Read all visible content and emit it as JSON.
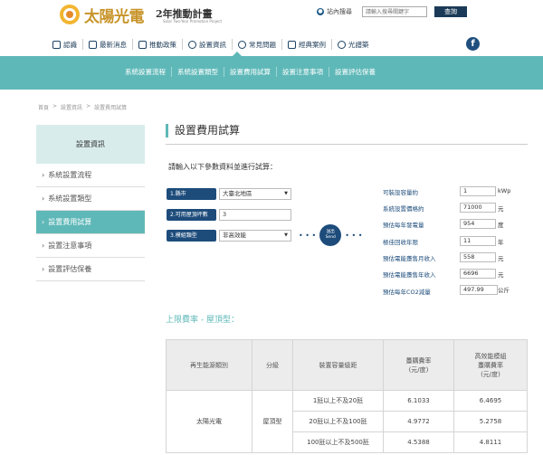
{
  "header": {
    "logo_title": "太陽光電",
    "logo_subtitle": "2年推動計畫",
    "logo_en": "Solar Two-Year Promotion Project",
    "sitemap_label": "站內搜尋",
    "search_placeholder": "請輸入搜尋關鍵字",
    "search_button": "查詢"
  },
  "nav": {
    "items": [
      {
        "label": "認識",
        "icon": "phone-icon"
      },
      {
        "label": "最新消息",
        "icon": "chart-icon"
      },
      {
        "label": "推動政策",
        "icon": "building-icon"
      },
      {
        "label": "設置資訊",
        "icon": "dollar-icon"
      },
      {
        "label": "常見問題",
        "icon": "question-icon"
      },
      {
        "label": "經典案例",
        "icon": "case-icon"
      },
      {
        "label": "光譜築",
        "icon": "panel-icon"
      }
    ],
    "facebook": "f"
  },
  "subnav": {
    "items": [
      "系統設置流程",
      "系統設置類型",
      "設置費用試算",
      "設置注意事項",
      "設置評估保養"
    ]
  },
  "breadcrumb": [
    "首頁",
    ">",
    "設置資訊",
    ">",
    "設置費用試算"
  ],
  "sidebar": {
    "heading": "設置資訊",
    "items": [
      {
        "label": "系統設置流程"
      },
      {
        "label": "系統設置類型"
      },
      {
        "label": "設置費用試算"
      },
      {
        "label": "設置注意事項"
      },
      {
        "label": "設置評估保養"
      }
    ]
  },
  "content": {
    "title": "設置費用試算",
    "instruction": "請輸入以下參數資料並進行試算：",
    "inputs": [
      {
        "label": "1.縣市",
        "value": "大臺北地區"
      },
      {
        "label": "2.可用屋頂坪數",
        "value": "3"
      },
      {
        "label": "3.模組類型",
        "value": "非高效能"
      }
    ],
    "send_label_1": "送出",
    "send_label_2": "Send",
    "outputs": [
      {
        "label": "可裝設容量約",
        "value": "1",
        "unit": "kWp"
      },
      {
        "label": "系統設置價格約",
        "value": "71000",
        "unit": "元"
      },
      {
        "label": "預估每年發電量",
        "value": "954",
        "unit": "度"
      },
      {
        "label": "極佳回收年限",
        "value": "11",
        "unit": "年"
      },
      {
        "label": "預估電能躉售月收入",
        "value": "558",
        "unit": "元"
      },
      {
        "label": "預估電能躉售年收入",
        "value": "6696",
        "unit": "元"
      },
      {
        "label": "預估每年CO2減量",
        "value": "497.99",
        "unit": "公斤"
      }
    ],
    "rate_title": "上限費率 - 屋頂型：",
    "table": {
      "headers": [
        "再生能源類別",
        "分級",
        "裝置容量級距",
        "躉購費率\n(元/度)",
        "高效能模組\n躉購費率\n(元/度)"
      ],
      "category": "太陽光電",
      "class": "屋頂型",
      "rows": [
        {
          "range": "1瓩以上不及20瓩",
          "rate": "6.1033",
          "high_rate": "6.4695"
        },
        {
          "range": "20瓩以上不及100瓩",
          "rate": "4.9772",
          "high_rate": "5.2758"
        },
        {
          "range": "100瓩以上不及500瓩",
          "rate": "4.5388",
          "high_rate": "4.8111"
        }
      ]
    }
  }
}
